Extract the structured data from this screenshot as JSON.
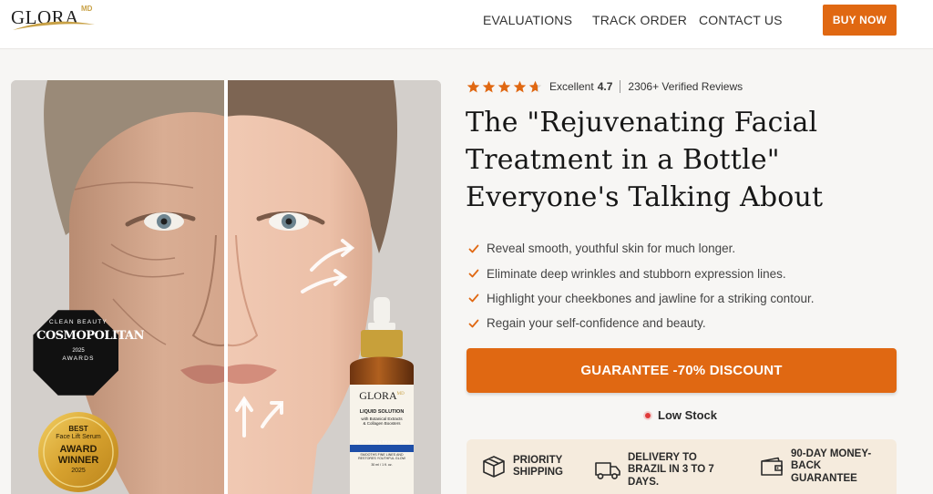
{
  "brand": {
    "logo_text": "GLORA",
    "logo_superscript": "MD",
    "accent": "#e06812",
    "gold": "#c8a146"
  },
  "nav": {
    "evaluations": "EVALUATIONS",
    "track_order": "TRACK ORDER",
    "contact_us": "CONTACT US",
    "buy_now": "BUY NOW"
  },
  "hero": {
    "badge_top": "CLEAN BEAUTY",
    "badge_brand": "COSMOPOLITAN",
    "badge_year": "2025",
    "badge_bottom": "AWARDS",
    "award_best": "BEST",
    "award_category": "Face Lift Serum",
    "award_title_1": "AWARD",
    "award_title_2": "WINNER",
    "award_year": "2025",
    "bottle_brand": "GLORA",
    "bottle_brand_sup": "MD",
    "bottle_line1": "LIQUID SOLUTION",
    "bottle_line2": "with Botanical Extracts",
    "bottle_line3": "& Collagen Boosters",
    "bottle_band": "RESTORING & REVITALIZING",
    "bottle_small1": "SMOOTHS FINE LINES AND",
    "bottle_small2": "RESTORES YOUTHFUL GLOW",
    "bottle_volume": "30 ml / 1 fl. oz."
  },
  "rating": {
    "stars": 4.7,
    "label": "Excellent",
    "score": "4.7",
    "reviews": "2306+ Verified Reviews"
  },
  "headline": {
    "line1": "The \"Rejuvenating Facial",
    "line2": "Treatment in a Bottle\"",
    "line3": "Everyone's Talking About"
  },
  "benefits": [
    "Reveal smooth, youthful skin for much longer.",
    "Eliminate deep wrinkles and stubborn expression lines.",
    "Highlight your cheekbones and jawline for a striking contour.",
    "Regain your self-confidence and beauty."
  ],
  "cta": {
    "label": "GUARANTEE -70% DISCOUNT"
  },
  "stock": {
    "label": "Low Stock"
  },
  "features": [
    {
      "icon": "package-icon",
      "label": "PRIORITY SHIPPING"
    },
    {
      "icon": "delivery-truck-icon",
      "label": "DELIVERY TO BRAZIL IN 3 TO 7 DAYS."
    },
    {
      "icon": "wallet-icon",
      "label": "90-DAY MONEY-BACK GUARANTEE"
    }
  ]
}
